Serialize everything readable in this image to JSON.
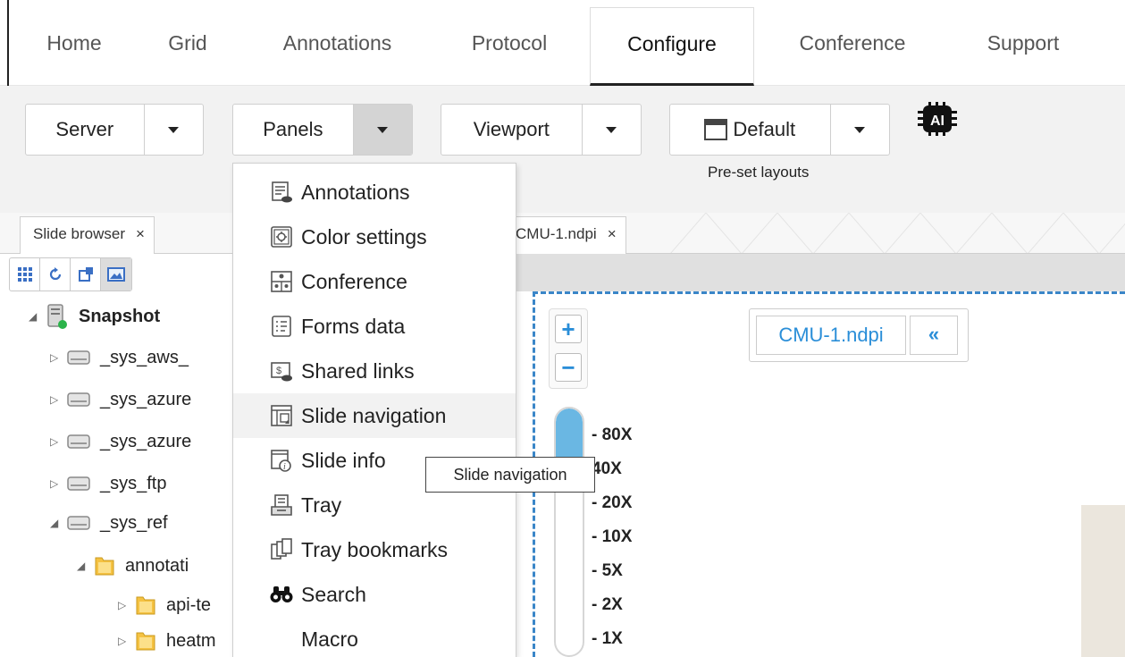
{
  "top_tabs": [
    {
      "label": "Home"
    },
    {
      "label": "Grid"
    },
    {
      "label": "Annotations"
    },
    {
      "label": "Protocol"
    },
    {
      "label": "Configure",
      "active": true
    },
    {
      "label": "Conference"
    },
    {
      "label": "Support"
    }
  ],
  "ribbon": {
    "server_label": "Server",
    "panels_label": "Panels",
    "viewport_label": "Viewport",
    "default_label": "Default",
    "preset_caption": "Pre-set layouts",
    "ai_badge": "AI"
  },
  "dock_tabs": {
    "slide_browser": "Slide browser",
    "viewer_tab": "CMU-1.ndpi",
    "close_glyph": "×"
  },
  "tree": {
    "root": "Snapshot",
    "items": [
      {
        "label": "_sys_aws_"
      },
      {
        "label": "_sys_azure"
      },
      {
        "label": "_sys_azure"
      },
      {
        "label": "_sys_ftp"
      },
      {
        "label": "_sys_ref"
      },
      {
        "label": "annotati"
      },
      {
        "label": "api-te"
      },
      {
        "label": "heatm"
      }
    ]
  },
  "panels_menu": {
    "items": [
      {
        "label": "Annotations",
        "icon": "annotations-icon"
      },
      {
        "label": "Color settings",
        "icon": "color-settings-icon"
      },
      {
        "label": "Conference",
        "icon": "conference-icon"
      },
      {
        "label": "Forms data",
        "icon": "forms-icon"
      },
      {
        "label": "Shared links",
        "icon": "shared-links-icon"
      },
      {
        "label": "Slide navigation",
        "icon": "slide-navigation-icon",
        "hover": true
      },
      {
        "label": "Slide info",
        "icon": "slide-info-icon"
      },
      {
        "label": "Tray",
        "icon": "tray-icon"
      },
      {
        "label": "Tray bookmarks",
        "icon": "tray-bookmarks-icon"
      },
      {
        "label": "Search",
        "icon": "binoculars-icon"
      },
      {
        "label": "Macro",
        "icon": ""
      }
    ]
  },
  "tooltip": "Slide navigation",
  "viewer": {
    "zoom_in": "+",
    "zoom_out": "−",
    "zoom_levels": [
      "- 80X",
      "40X",
      "- 20X",
      "- 10X",
      "- 5X",
      "- 2X",
      "- 1X"
    ],
    "current_zoom_fraction_from_top": 0.33,
    "filename": "CMU-1.ndpi",
    "collapse_glyph": "«"
  },
  "colors": {
    "accent_blue": "#2a8ed8",
    "slider_fill": "#6ab7e3",
    "status_green": "#2bb34a"
  }
}
